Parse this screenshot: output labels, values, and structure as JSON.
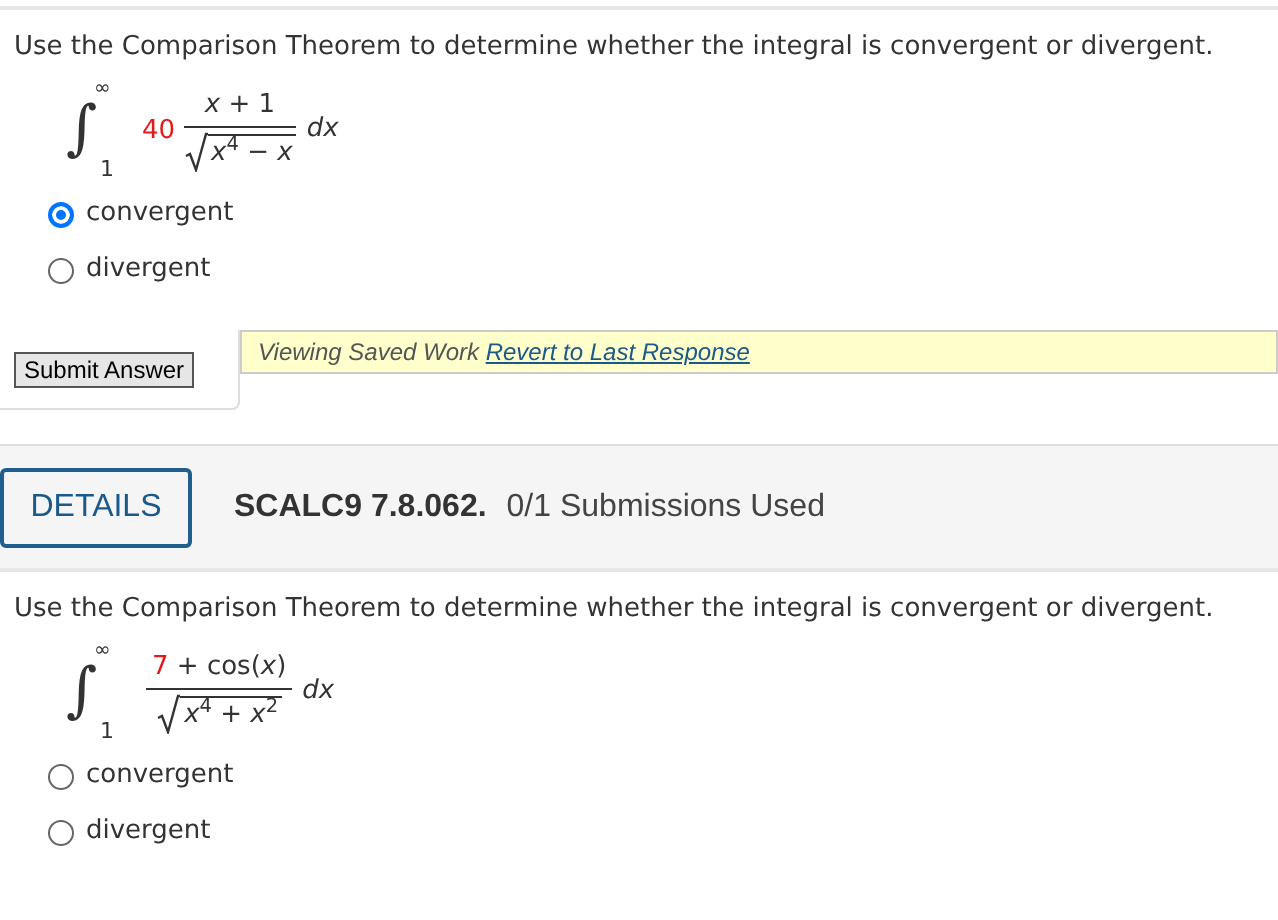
{
  "questions": [
    {
      "prompt": "Use the Comparison Theorem to determine whether the integral is convergent or divergent.",
      "integral": {
        "sign": "∫",
        "upper": "∞",
        "lower": "1",
        "coefficient": {
          "text": "40",
          "color": "#e31b1b"
        },
        "numerator": [
          {
            "text": "*x* + 1"
          }
        ],
        "denominator": "*x*$^{4}$ − *x*",
        "differential": "*dx*"
      },
      "options": [
        {
          "label": "convergent",
          "selected": true
        },
        {
          "label": "divergent",
          "selected": false
        }
      ]
    },
    {
      "prompt": "Use the Comparison Theorem to determine whether the integral is convergent or divergent.",
      "integral": {
        "sign": "∫",
        "upper": "∞",
        "lower": "1",
        "numerator": [
          {
            "text": "7",
            "color": "#e31b1b"
          },
          {
            "text": " + cos(*x*)"
          }
        ],
        "denominator": "*x*$^{4}$ + *x*$^{2}$",
        "differential": "*dx*"
      },
      "options": [
        {
          "label": "convergent",
          "selected": false
        },
        {
          "label": "divergent",
          "selected": false
        }
      ]
    }
  ],
  "submit_button": "Submit Answer",
  "saved_notice": {
    "text": "Viewing Saved Work",
    "link": "Revert to Last Response"
  },
  "details_bar": {
    "button": "DETAILS",
    "problem_id": "SCALC9 7.8.062.",
    "submissions": "0/1 Submissions Used"
  }
}
